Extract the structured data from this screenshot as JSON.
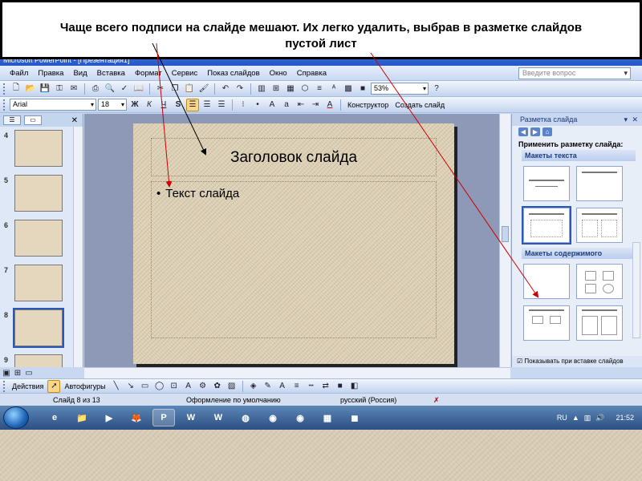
{
  "caption": {
    "line1": "Чаще всего подписи на слайде мешают. Их легко удалить, выбрав в разметке слайдов",
    "line2": "пустой лист"
  },
  "window": {
    "title": "Microsoft PowerPoint - [Презентация1]"
  },
  "menu": {
    "items": [
      "Файл",
      "Правка",
      "Вид",
      "Вставка",
      "Формат",
      "Сервис",
      "Показ слайдов",
      "Окно",
      "Справка"
    ],
    "help_placeholder": "Введите вопрос"
  },
  "toolbar1": {
    "zoom": "53%"
  },
  "toolbar2": {
    "font": "Arial",
    "size": "18",
    "bold": "Ж",
    "italic": "К",
    "underline": "Ч",
    "shadow": "S",
    "constructor": "Конструктор",
    "create_slide": "Создать слайд"
  },
  "thumbnails": [
    {
      "num": "4"
    },
    {
      "num": "5"
    },
    {
      "num": "6"
    },
    {
      "num": "7"
    },
    {
      "num": "8",
      "selected": true
    },
    {
      "num": "9"
    }
  ],
  "slide": {
    "title": "Заголовок слайда",
    "bullet": "•",
    "body": "Текст слайда"
  },
  "task_pane": {
    "title": "Разметка слайда",
    "apply_label": "Применить разметку слайда:",
    "section_text": "Макеты текста",
    "section_content": "Макеты содержимого",
    "show_on_insert": "Показывать при вставке слайдов"
  },
  "drawbar": {
    "actions": "Действия",
    "autoshapes": "Автофигуры"
  },
  "status": {
    "slide_info": "Слайд 8 из 13",
    "design": "Оформление по умолчанию",
    "language": "русский (Россия)"
  },
  "taskbar": {
    "lang": "RU",
    "time": "21:52"
  },
  "colors": {
    "arrow_black": "#000000",
    "arrow_red": "#cc0000",
    "accent": "#2b58b8"
  }
}
